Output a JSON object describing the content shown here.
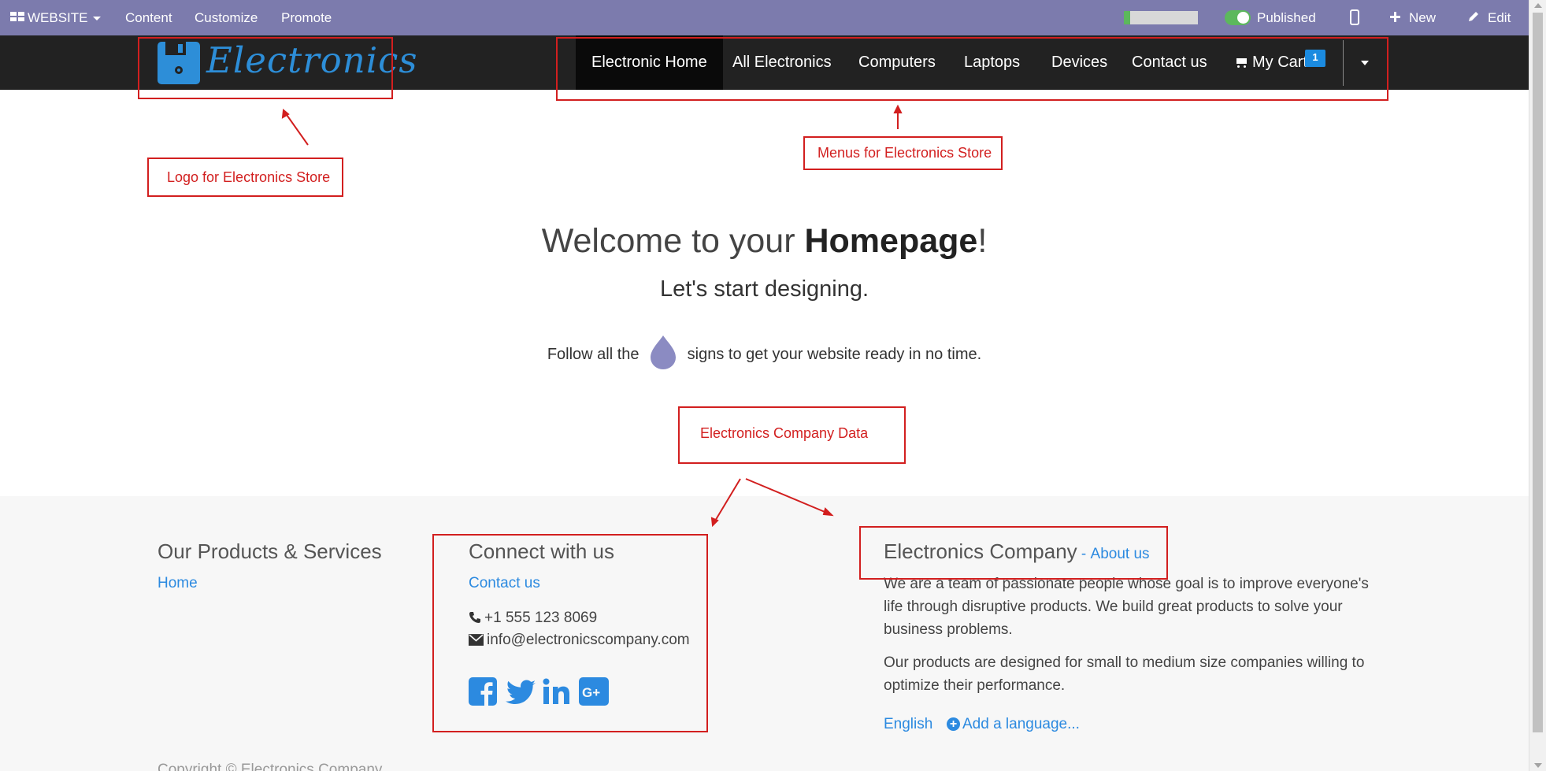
{
  "admin_bar": {
    "website_label": "WEBSITE",
    "menu": [
      "Content",
      "Customize",
      "Promote"
    ],
    "seo_progress": 0.08,
    "published_label": "Published",
    "new_label": "New",
    "edit_label": "Edit",
    "accent_color": "#7c7bad"
  },
  "logo": {
    "text": "Electronics"
  },
  "nav": {
    "items": [
      "Electronic Home",
      "All Electronics",
      "Computers",
      "Laptops",
      "Devices",
      "Contact us"
    ],
    "cart_label": "My Cart",
    "cart_count": "1"
  },
  "annotations": {
    "logo": "Logo for Electronics Store",
    "menus": "Menus for Electronics Store",
    "company_data": "Electronics Company Data"
  },
  "hero": {
    "title_prefix": "Welcome to your ",
    "title_bold": "Homepage",
    "title_suffix": "!",
    "subtitle": "Let's start designing.",
    "follow_prefix": "Follow all the",
    "follow_suffix": "signs to get your website ready in no time."
  },
  "footer": {
    "products": {
      "heading": "Our Products & Services",
      "links": [
        "Home"
      ]
    },
    "connect": {
      "heading": "Connect with us",
      "contact_link": "Contact us",
      "phone": "+1 555 123 8069",
      "email": "info@electronicscompany.com",
      "social": [
        "facebook",
        "twitter",
        "linkedin",
        "google-plus"
      ]
    },
    "company": {
      "name": "Electronics Company",
      "separator": " - ",
      "about_link": "About us",
      "para1": "We are a team of passionate people whose goal is to improve everyone's life through disruptive products. We build great products to solve your business problems.",
      "para2": "Our products are designed for small to medium size companies willing to optimize their performance.",
      "language": "English",
      "add_language": "Add a language..."
    },
    "copyright": "Copyright © Electronics Company"
  }
}
